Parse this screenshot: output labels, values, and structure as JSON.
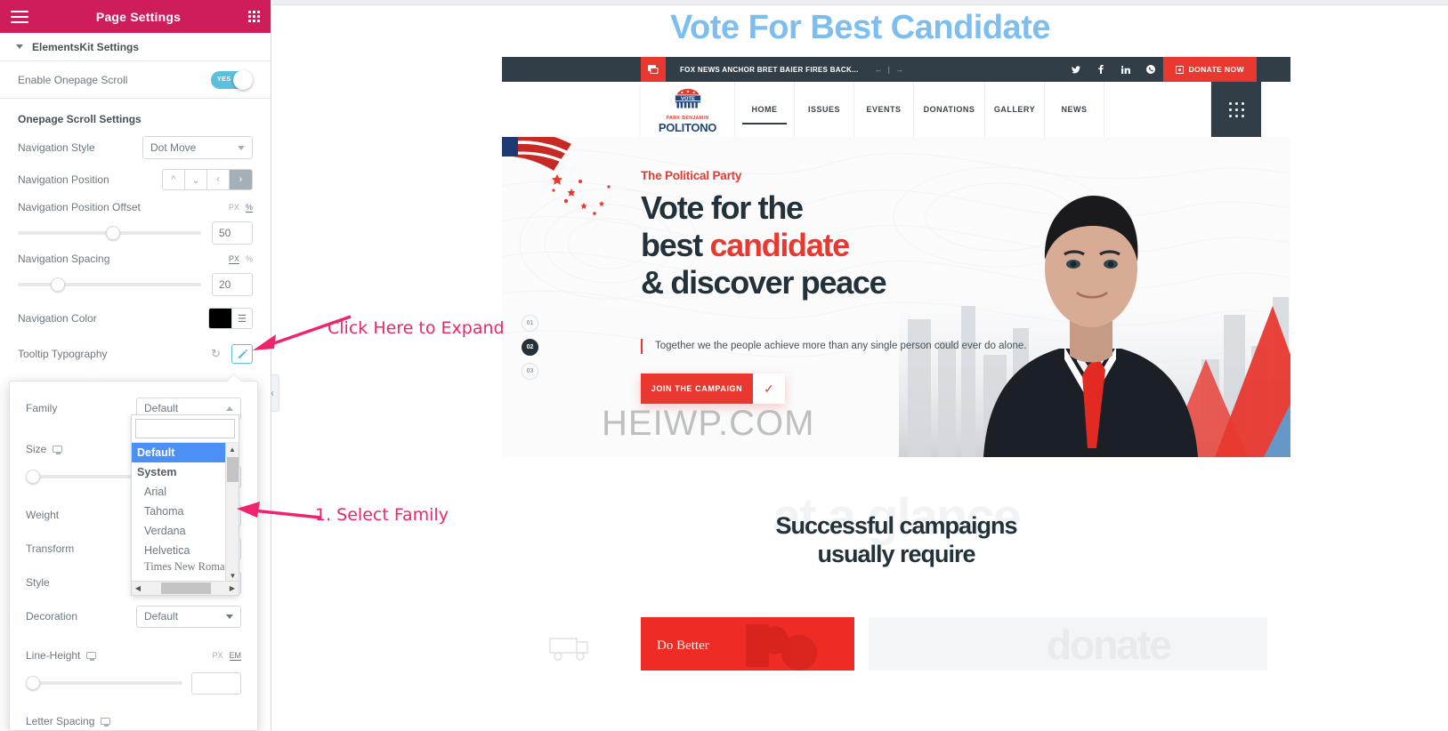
{
  "panel": {
    "header": {
      "title": "Page Settings",
      "menu_icon": "hamburger-icon",
      "apps_icon": "grid-apps-icon"
    },
    "section": {
      "title": "ElementsKit Settings"
    },
    "controls": {
      "enable_onepage_scroll": {
        "label": "Enable Onepage Scroll",
        "value": "YES"
      },
      "group_title": "Onepage Scroll Settings",
      "navigation_style": {
        "label": "Navigation Style",
        "value": "Dot Move"
      },
      "navigation_position": {
        "label": "Navigation Position",
        "options": [
          "up",
          "down",
          "left",
          "right"
        ],
        "active": "right"
      },
      "navigation_position_offset": {
        "label": "Navigation Position Offset",
        "units": [
          "PX",
          "%"
        ],
        "active_unit": "%",
        "value": "50"
      },
      "navigation_spacing": {
        "label": "Navigation Spacing",
        "units": [
          "PX",
          "%"
        ],
        "active_unit": "PX",
        "value": "20"
      },
      "navigation_color": {
        "label": "Navigation Color",
        "swatch": "#000000"
      },
      "tooltip_typography": {
        "label": "Tooltip Typography",
        "reset_icon": "reset-icon",
        "edit_icon": "pencil-edit-icon"
      }
    }
  },
  "typography_popover": {
    "family": {
      "label": "Family",
      "value": "Default"
    },
    "size": {
      "label": "Size",
      "device_icon": "desktop-icon",
      "value": ""
    },
    "weight": {
      "label": "Weight"
    },
    "transform": {
      "label": "Transform"
    },
    "style": {
      "label": "Style"
    },
    "decoration": {
      "label": "Decoration",
      "value": "Default"
    },
    "line_height": {
      "label": "Line-Height",
      "device_icon": "desktop-icon",
      "units": [
        "PX",
        "EM"
      ],
      "active_unit": "EM",
      "value": ""
    },
    "letter_spacing": {
      "label": "Letter Spacing",
      "device_icon": "desktop-icon"
    },
    "family_dropdown": {
      "search_value": "",
      "options": [
        {
          "label": "Default",
          "type": "option",
          "selected": true
        },
        {
          "label": "System",
          "type": "group"
        },
        {
          "label": "Arial",
          "type": "option"
        },
        {
          "label": "Tahoma",
          "type": "option"
        },
        {
          "label": "Verdana",
          "type": "option"
        },
        {
          "label": "Helvetica",
          "type": "option"
        },
        {
          "label": "Times New Roman",
          "type": "option"
        }
      ]
    }
  },
  "collapse_tab": {
    "icon": "chevron-left-icon"
  },
  "annotations": [
    {
      "text": "Click Here to Expand"
    },
    {
      "text": "1. Select Family"
    }
  ],
  "preview": {
    "page_heading": "Vote For Best Candidate",
    "announcement": {
      "icon": "news-chat-icon",
      "text": "FOX NEWS ANCHOR BRET BAIER FIRES BACK...",
      "prev": "←",
      "divider": "|",
      "next": "→",
      "socials": [
        "twitter-icon",
        "facebook-icon",
        "linkedin-icon",
        "whatsapp-icon"
      ],
      "donate_label": "DONATE NOW",
      "donate_icon": "donate-card-icon"
    },
    "nav": {
      "logo": {
        "badge": "VOTE",
        "pre_name": "PARK  BENJAMIN",
        "name": "POLITONO"
      },
      "items": [
        {
          "label": "HOME",
          "active": true
        },
        {
          "label": "ISSUES",
          "active": false
        },
        {
          "label": "EVENTS",
          "active": false
        },
        {
          "label": "DONATIONS",
          "active": false
        },
        {
          "label": "GALLERY",
          "active": false
        },
        {
          "label": "NEWS",
          "active": false
        }
      ],
      "menu_icon": "grid-dots-icon"
    },
    "hero": {
      "eyebrow": "The Political Party",
      "title_line1": "Vote for the",
      "title_line2_a": "best ",
      "title_line2_b": "candidate",
      "title_line3": "& discover peace",
      "lead": "Together we the people achieve more than any single person could ever do alone.",
      "cta_label": "JOIN THE CAMPAIGN",
      "cta_check": "✓",
      "slider_dots": [
        {
          "label": "01",
          "active": false
        },
        {
          "label": "02",
          "active": true
        },
        {
          "label": "03",
          "active": false
        }
      ],
      "watermark": "HEIWP.COM"
    },
    "glance": {
      "ghost_text": "at a glance",
      "heading_line1": "Successful campaigns",
      "heading_line2": "usually require",
      "card_scribble": "Do Better",
      "card_ghost_text": "donate"
    }
  },
  "colors": {
    "panel_header": "#cf1d5c",
    "accent_blue": "#5bc0de",
    "annotation_pink": "#f0246e",
    "site_red": "#e8382f",
    "site_dark": "#313e47",
    "heading_blue": "#7dbef0",
    "dropdown_selected": "#4a90f7"
  }
}
